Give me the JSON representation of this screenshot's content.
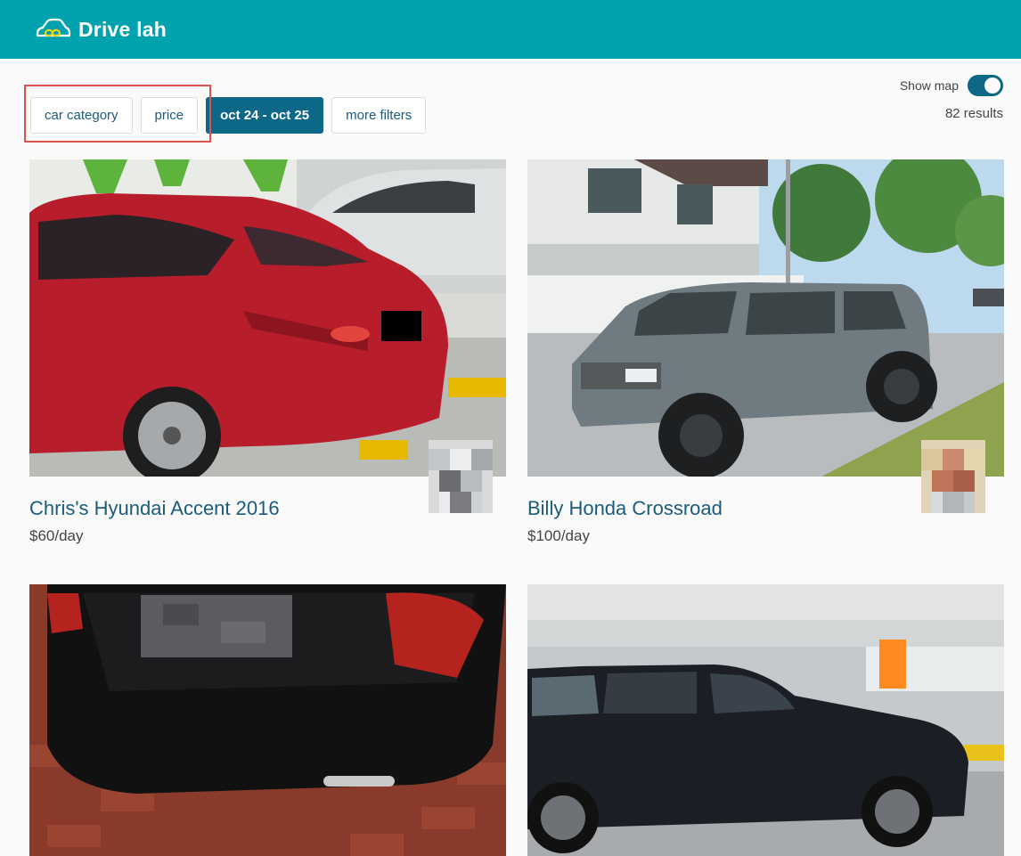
{
  "app": {
    "name": "Drive lah"
  },
  "filters": [
    {
      "label": "car category",
      "active": false
    },
    {
      "label": "price",
      "active": false
    },
    {
      "label": "oct 24 - oct 25",
      "active": true
    },
    {
      "label": "more filters",
      "active": false
    }
  ],
  "show_map": {
    "label": "Show map",
    "enabled": true
  },
  "results": {
    "count_label": "82 results"
  },
  "listings": [
    {
      "title": "Chris's Hyundai Accent 2016",
      "price": "$60/day",
      "car_color": "#b81d2c"
    },
    {
      "title": "Billy Honda Crossroad",
      "price": "$100/day",
      "car_color": "#6f7b80"
    },
    {
      "title": "",
      "price": "",
      "car_color": "#111111"
    },
    {
      "title": "",
      "price": "",
      "car_color": "#1b1e24"
    }
  ],
  "colors": {
    "header": "#00a3ad",
    "accent": "#0d6786",
    "highlight": "#d9534f"
  }
}
